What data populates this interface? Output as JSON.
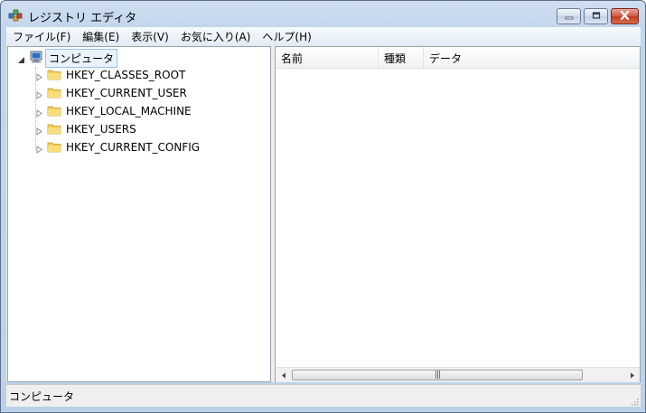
{
  "window": {
    "title": "レジストリ エディタ",
    "icon": "registry-editor-icon",
    "controls": {
      "minimize": "minimize-icon",
      "maximize": "maximize-icon",
      "close": "close-icon"
    }
  },
  "menubar": [
    {
      "label": "ファイル(F)"
    },
    {
      "label": "編集(E)"
    },
    {
      "label": "表示(V)"
    },
    {
      "label": "お気に入り(A)"
    },
    {
      "label": "ヘルプ(H)"
    }
  ],
  "tree": {
    "root": {
      "label": "コンピュータ",
      "icon": "computer-icon",
      "expanded": true
    },
    "children": [
      {
        "label": "HKEY_CLASSES_ROOT",
        "icon": "folder-icon"
      },
      {
        "label": "HKEY_CURRENT_USER",
        "icon": "folder-icon"
      },
      {
        "label": "HKEY_LOCAL_MACHINE",
        "icon": "folder-icon"
      },
      {
        "label": "HKEY_USERS",
        "icon": "folder-icon"
      },
      {
        "label": "HKEY_CURRENT_CONFIG",
        "icon": "folder-icon"
      }
    ]
  },
  "list": {
    "columns": [
      {
        "label": "名前"
      },
      {
        "label": "種類"
      },
      {
        "label": "データ"
      }
    ],
    "rows": []
  },
  "statusbar": {
    "text": "コンピュータ"
  },
  "colors": {
    "titlebar": "#c2d6ec",
    "close_button": "#c23b20",
    "folder": "#f3cf5a",
    "selection_border": "#9bc3e6"
  }
}
